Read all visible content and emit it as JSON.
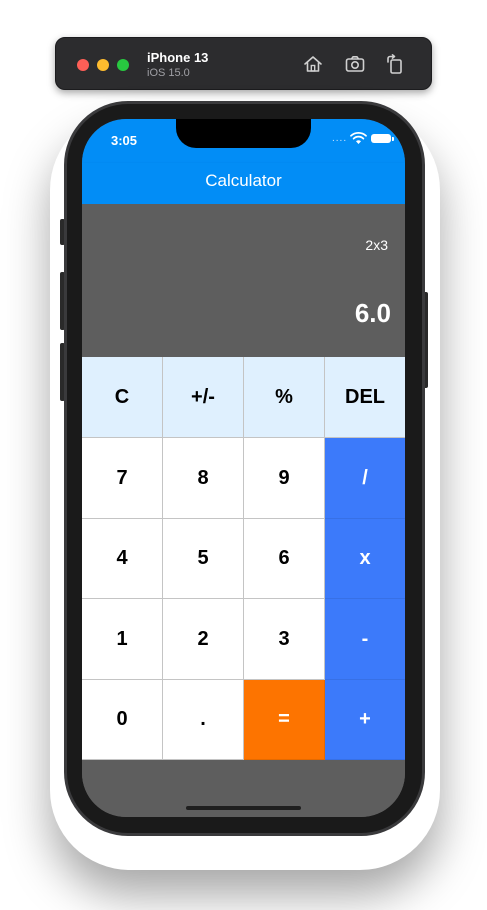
{
  "simulator": {
    "device_name": "iPhone 13",
    "os_version": "iOS 15.0",
    "icons": [
      "home-icon",
      "screenshot-icon",
      "rotate-icon"
    ]
  },
  "status_bar": {
    "time": "3:05",
    "signal": "....",
    "icons": [
      "wifi-icon",
      "battery-icon"
    ]
  },
  "app_bar": {
    "title": "Calculator"
  },
  "display": {
    "expression": "2x3",
    "result": "6.0"
  },
  "keypad": {
    "row1": [
      "C",
      "+/-",
      "%",
      "DEL"
    ],
    "row2": [
      "7",
      "8",
      "9",
      "/"
    ],
    "row3": [
      "4",
      "5",
      "6",
      "x"
    ],
    "row4": [
      "1",
      "2",
      "3",
      "-"
    ],
    "row5": [
      "0",
      ".",
      "=",
      "+"
    ]
  },
  "colors": {
    "app_bar": "#028df6",
    "display_bg": "#5e5e5e",
    "function_key_bg": "#dff0fe",
    "operator_key_bg": "#3c7afa",
    "equals_key_bg": "#fd7400"
  }
}
